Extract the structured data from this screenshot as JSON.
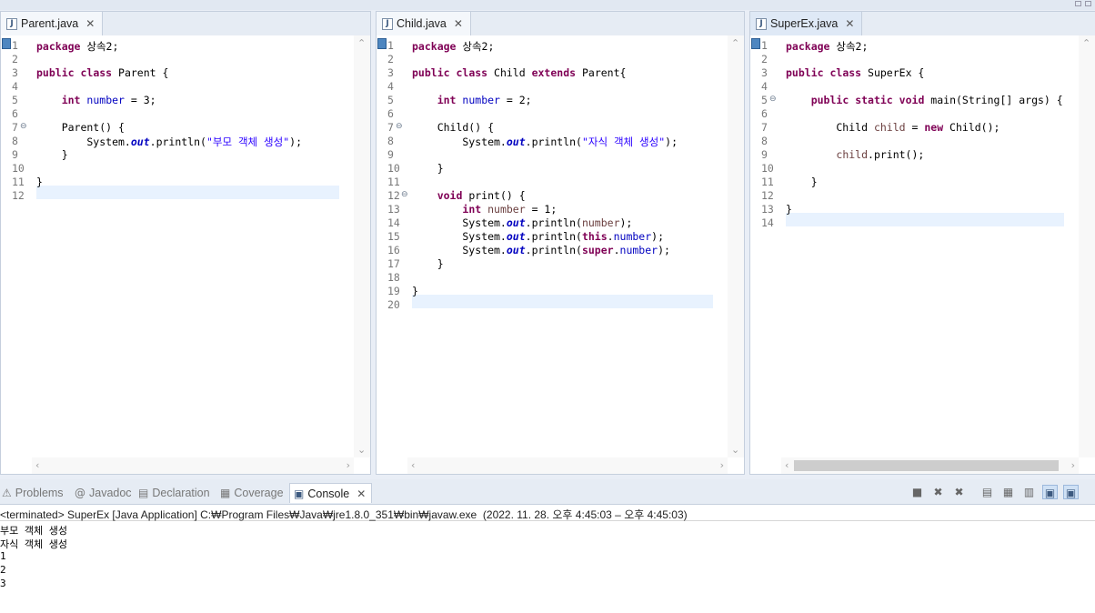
{
  "editors": [
    {
      "tab": "Parent.java",
      "line_numbers": [
        "1",
        "2",
        "3",
        "4",
        "5",
        "6",
        "7",
        "8",
        "9",
        "10",
        "11",
        "12"
      ],
      "lines": [
        [
          {
            "t": "package",
            "c": "kw"
          },
          {
            "t": " 상속2;"
          }
        ],
        [],
        [
          {
            "t": "public",
            "c": "kw"
          },
          {
            "t": " "
          },
          {
            "t": "class",
            "c": "kw"
          },
          {
            "t": " Parent {"
          }
        ],
        [],
        [
          {
            "t": "    "
          },
          {
            "t": "int",
            "c": "kw"
          },
          {
            "t": " "
          },
          {
            "t": "number",
            "c": "fld"
          },
          {
            "t": " = 3;"
          }
        ],
        [],
        [
          {
            "t": "    Parent() {"
          }
        ],
        [
          {
            "t": "        System."
          },
          {
            "t": "out",
            "c": "sfld"
          },
          {
            "t": ".println("
          },
          {
            "t": "\"부모 객체 생성\"",
            "c": "str"
          },
          {
            "t": ");"
          }
        ],
        [
          {
            "t": "    }"
          }
        ],
        [],
        [
          {
            "t": "}"
          }
        ],
        []
      ]
    },
    {
      "tab": "Child.java",
      "line_numbers": [
        "1",
        "2",
        "3",
        "4",
        "5",
        "6",
        "7",
        "8",
        "9",
        "10",
        "11",
        "12",
        "13",
        "14",
        "15",
        "16",
        "17",
        "18",
        "19",
        "20"
      ],
      "lines": [
        [
          {
            "t": "package",
            "c": "kw"
          },
          {
            "t": " 상속2;"
          }
        ],
        [],
        [
          {
            "t": "public",
            "c": "kw"
          },
          {
            "t": " "
          },
          {
            "t": "class",
            "c": "kw"
          },
          {
            "t": " Child "
          },
          {
            "t": "extends",
            "c": "kw"
          },
          {
            "t": " Parent{"
          }
        ],
        [],
        [
          {
            "t": "    "
          },
          {
            "t": "int",
            "c": "kw"
          },
          {
            "t": " "
          },
          {
            "t": "number",
            "c": "fld"
          },
          {
            "t": " = 2;"
          }
        ],
        [],
        [
          {
            "t": "    Child() {"
          }
        ],
        [
          {
            "t": "        System."
          },
          {
            "t": "out",
            "c": "sfld"
          },
          {
            "t": ".println("
          },
          {
            "t": "\"자식 객체 생성\"",
            "c": "str"
          },
          {
            "t": ");"
          }
        ],
        [],
        [
          {
            "t": "    }"
          }
        ],
        [],
        [
          {
            "t": "    "
          },
          {
            "t": "void",
            "c": "kw"
          },
          {
            "t": " print() {"
          }
        ],
        [
          {
            "t": "        "
          },
          {
            "t": "int",
            "c": "kw"
          },
          {
            "t": " "
          },
          {
            "t": "number",
            "c": "lv"
          },
          {
            "t": " = 1;"
          }
        ],
        [
          {
            "t": "        System."
          },
          {
            "t": "out",
            "c": "sfld"
          },
          {
            "t": ".println("
          },
          {
            "t": "number",
            "c": "lv"
          },
          {
            "t": ");"
          }
        ],
        [
          {
            "t": "        System."
          },
          {
            "t": "out",
            "c": "sfld"
          },
          {
            "t": ".println("
          },
          {
            "t": "this",
            "c": "kw"
          },
          {
            "t": "."
          },
          {
            "t": "number",
            "c": "fld"
          },
          {
            "t": ");"
          }
        ],
        [
          {
            "t": "        System."
          },
          {
            "t": "out",
            "c": "sfld"
          },
          {
            "t": ".println("
          },
          {
            "t": "super",
            "c": "kw"
          },
          {
            "t": "."
          },
          {
            "t": "number",
            "c": "fld"
          },
          {
            "t": ");"
          }
        ],
        [
          {
            "t": "    }"
          }
        ],
        [],
        [
          {
            "t": "}"
          }
        ],
        []
      ]
    },
    {
      "tab": "SuperEx.java",
      "line_numbers": [
        "1",
        "2",
        "3",
        "4",
        "5",
        "6",
        "7",
        "8",
        "9",
        "10",
        "11",
        "12",
        "13",
        "14"
      ],
      "lines": [
        [
          {
            "t": "package",
            "c": "kw"
          },
          {
            "t": " 상속2;"
          }
        ],
        [],
        [
          {
            "t": "public",
            "c": "kw"
          },
          {
            "t": " "
          },
          {
            "t": "class",
            "c": "kw"
          },
          {
            "t": " SuperEx {"
          }
        ],
        [],
        [
          {
            "t": "    "
          },
          {
            "t": "public",
            "c": "kw"
          },
          {
            "t": " "
          },
          {
            "t": "static",
            "c": "kw"
          },
          {
            "t": " "
          },
          {
            "t": "void",
            "c": "kw"
          },
          {
            "t": " main(String[] args) {"
          }
        ],
        [],
        [
          {
            "t": "        Child "
          },
          {
            "t": "child",
            "c": "lv"
          },
          {
            "t": " = "
          },
          {
            "t": "new",
            "c": "kw"
          },
          {
            "t": " Child();"
          }
        ],
        [],
        [
          {
            "t": "        "
          },
          {
            "t": "child",
            "c": "lv"
          },
          {
            "t": ".print();"
          }
        ],
        [],
        [
          {
            "t": "    }"
          }
        ],
        [],
        [
          {
            "t": "}"
          }
        ],
        []
      ]
    }
  ],
  "bottom_tabs": [
    {
      "label": "Problems",
      "icon": "problems-icon",
      "glyph": "⚠"
    },
    {
      "label": "Javadoc",
      "icon": "javadoc-icon",
      "glyph": "@"
    },
    {
      "label": "Declaration",
      "icon": "declaration-icon",
      "glyph": "▤"
    },
    {
      "label": "Coverage",
      "icon": "coverage-icon",
      "glyph": "▦"
    },
    {
      "label": "Console",
      "icon": "console-icon",
      "glyph": "▣"
    }
  ],
  "console": {
    "header": "<terminated> SuperEx [Java Application] C:₩Program Files₩Java₩jre1.8.0_351₩bin₩javaw.exe  (2022. 11. 28. 오후 4:45:03 – 오후 4:45:03)",
    "output": [
      "부모 객체 생성",
      "자식 객체 생성",
      "1",
      "2",
      "3"
    ]
  },
  "toolbar_icons": [
    {
      "name": "terminate-icon",
      "glyph": "■"
    },
    {
      "name": "remove-launch-icon",
      "glyph": "✖"
    },
    {
      "name": "remove-all-terminated-icon",
      "glyph": "✖"
    },
    {
      "name": "scroll-lock-icon",
      "glyph": "▤"
    },
    {
      "name": "word-wrap-icon",
      "glyph": "▦"
    },
    {
      "name": "pin-console-icon",
      "glyph": "▥"
    },
    {
      "name": "display-selected-console-icon",
      "glyph": "▣"
    },
    {
      "name": "open-console-icon",
      "glyph": "▣"
    }
  ],
  "colors": {
    "keyword": "#7f0055",
    "field": "#0000c0",
    "string": "#2a00ff",
    "local": "#6a3e3e",
    "current_line": "#e8f2fe"
  }
}
